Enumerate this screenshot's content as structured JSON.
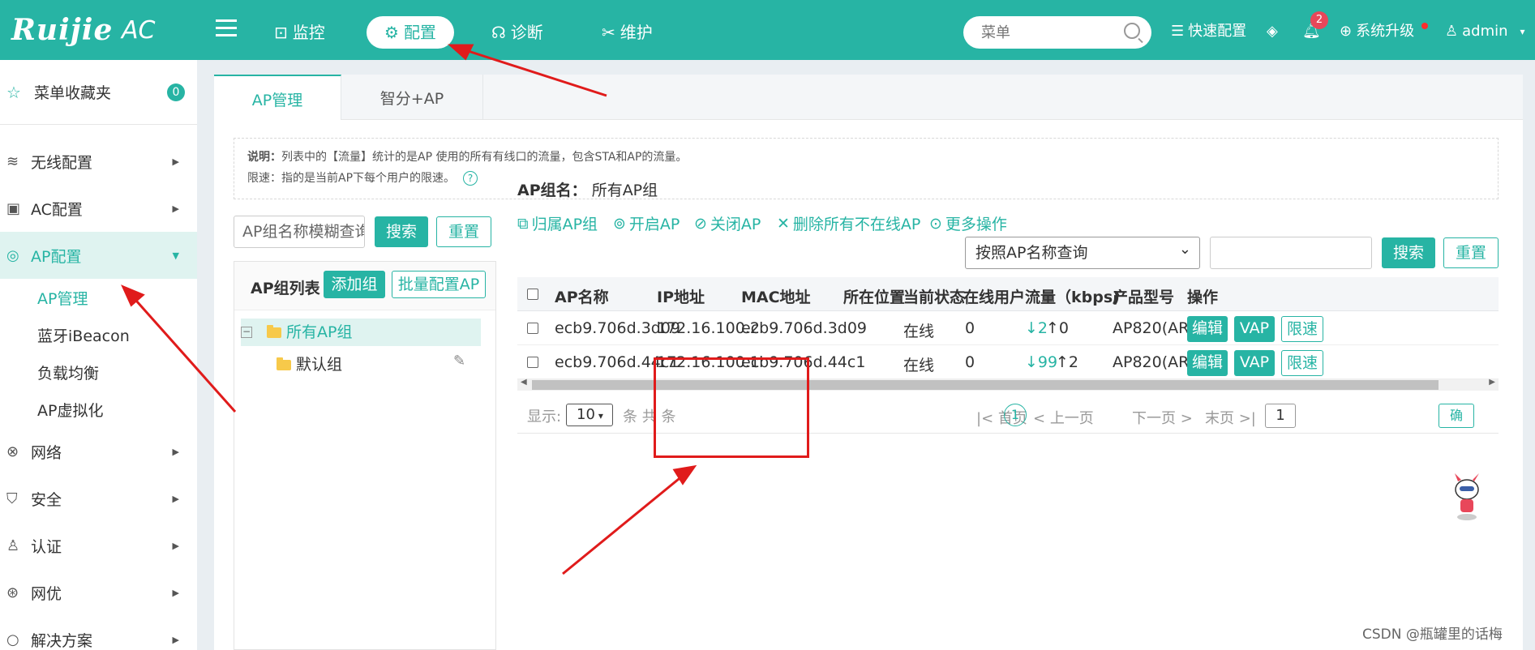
{
  "header": {
    "brand": "Ruijie",
    "brand_sub": "AC",
    "nav": [
      {
        "label": "监控",
        "icon": "monitor-icon"
      },
      {
        "label": "配置",
        "icon": "gear-icon"
      },
      {
        "label": "诊断",
        "icon": "stethoscope-icon"
      },
      {
        "label": "维护",
        "icon": "tools-icon"
      }
    ],
    "search_placeholder": "菜单",
    "quick_config": "快速配置",
    "notifications": "2",
    "upgrade": "系统升级",
    "user": "admin"
  },
  "sidebar": {
    "favorites": {
      "label": "菜单收藏夹",
      "count": "0"
    },
    "items": [
      {
        "label": "无线配置"
      },
      {
        "label": "AC配置"
      },
      {
        "label": "AP配置"
      },
      {
        "label": "网络"
      },
      {
        "label": "安全"
      },
      {
        "label": "认证"
      },
      {
        "label": "网优"
      },
      {
        "label": "解决方案"
      }
    ],
    "sub_items": [
      {
        "label": "AP管理"
      },
      {
        "label": "蓝牙iBeacon"
      },
      {
        "label": "负载均衡"
      },
      {
        "label": "AP虚拟化"
      }
    ]
  },
  "tabs": [
    {
      "label": "AP管理"
    },
    {
      "label": "智分+AP"
    }
  ],
  "note": {
    "line1_label": "说明：",
    "line1": "列表中的【流量】统计的是AP 使用的所有有线口的流量，包含STA和AP的流量。",
    "line2": "限速：指的是当前AP下每个用户的限速。"
  },
  "group_search": {
    "placeholder": "AP组名称模糊查询",
    "search": "搜索",
    "reset": "重置"
  },
  "group_panel": {
    "title": "AP组列表",
    "add": "添加组",
    "batch": "批量配置AP",
    "tree": [
      {
        "label": "所有AP组"
      },
      {
        "label": "默认组"
      }
    ]
  },
  "ap_group": {
    "label": "AP组名：",
    "value": "所有AP组"
  },
  "actions": [
    {
      "label": "归属AP组"
    },
    {
      "label": "开启AP"
    },
    {
      "label": "关闭AP"
    },
    {
      "label": "删除所有不在线AP"
    },
    {
      "label": "更多操作"
    }
  ],
  "filter": {
    "select": "按照AP名称查询",
    "search": "搜索",
    "reset": "重置"
  },
  "table": {
    "columns": [
      "AP名称",
      "IP地址",
      "MAC地址",
      "所在位置",
      "当前状态",
      "在线用户",
      "流量（kbps)",
      "产品型号",
      "操作"
    ],
    "rows": [
      {
        "name": "ecb9.706d.3d09",
        "ip": "172.16.100.2",
        "mac": "ecb9.706d.3d09",
        "location": "",
        "status": "在线",
        "users": "0",
        "down": "↓2",
        "up": "↑0",
        "model": "AP820(AR)"
      },
      {
        "name": "ecb9.706d.44c1",
        "ip": "172.16.100.1",
        "mac": "ecb9.706d.44c1",
        "location": "",
        "status": "在线",
        "users": "0",
        "down": "↓99",
        "up": "↑2",
        "model": "AP820(AR)"
      }
    ],
    "row_actions": [
      "编辑",
      "VAP",
      "限速"
    ]
  },
  "pager": {
    "show": "显示:",
    "per_page": "10",
    "total": "条 共 条",
    "first": "首页",
    "prev": "上一页",
    "current": "1",
    "next": "下一页",
    "last": "末页",
    "goto": "1",
    "confirm": "确"
  },
  "watermark": "CSDN @瓶罐里的话梅",
  "colors": {
    "accent": "#27b4a4",
    "annotation": "#e01b1b"
  }
}
